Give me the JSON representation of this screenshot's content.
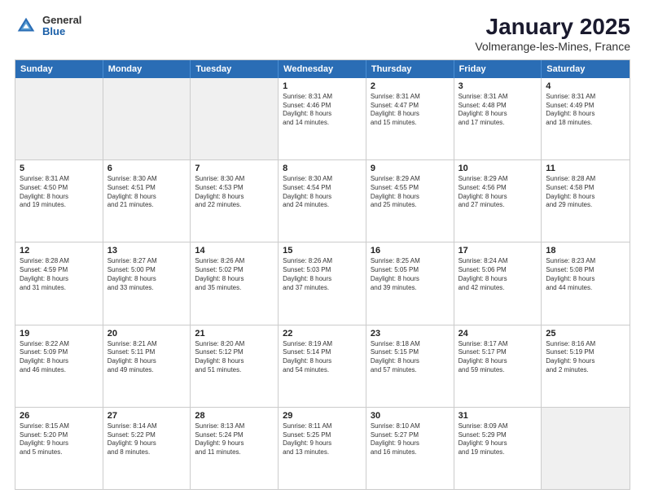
{
  "app": {
    "logo_general": "General",
    "logo_blue": "Blue"
  },
  "header": {
    "title": "January 2025",
    "subtitle": "Volmerange-les-Mines, France"
  },
  "calendar": {
    "weekdays": [
      "Sunday",
      "Monday",
      "Tuesday",
      "Wednesday",
      "Thursday",
      "Friday",
      "Saturday"
    ],
    "rows": [
      [
        {
          "day": "",
          "info": "",
          "shaded": true
        },
        {
          "day": "",
          "info": "",
          "shaded": true
        },
        {
          "day": "",
          "info": "",
          "shaded": true
        },
        {
          "day": "1",
          "info": "Sunrise: 8:31 AM\nSunset: 4:46 PM\nDaylight: 8 hours\nand 14 minutes."
        },
        {
          "day": "2",
          "info": "Sunrise: 8:31 AM\nSunset: 4:47 PM\nDaylight: 8 hours\nand 15 minutes."
        },
        {
          "day": "3",
          "info": "Sunrise: 8:31 AM\nSunset: 4:48 PM\nDaylight: 8 hours\nand 17 minutes."
        },
        {
          "day": "4",
          "info": "Sunrise: 8:31 AM\nSunset: 4:49 PM\nDaylight: 8 hours\nand 18 minutes."
        }
      ],
      [
        {
          "day": "5",
          "info": "Sunrise: 8:31 AM\nSunset: 4:50 PM\nDaylight: 8 hours\nand 19 minutes."
        },
        {
          "day": "6",
          "info": "Sunrise: 8:30 AM\nSunset: 4:51 PM\nDaylight: 8 hours\nand 21 minutes."
        },
        {
          "day": "7",
          "info": "Sunrise: 8:30 AM\nSunset: 4:53 PM\nDaylight: 8 hours\nand 22 minutes."
        },
        {
          "day": "8",
          "info": "Sunrise: 8:30 AM\nSunset: 4:54 PM\nDaylight: 8 hours\nand 24 minutes."
        },
        {
          "day": "9",
          "info": "Sunrise: 8:29 AM\nSunset: 4:55 PM\nDaylight: 8 hours\nand 25 minutes."
        },
        {
          "day": "10",
          "info": "Sunrise: 8:29 AM\nSunset: 4:56 PM\nDaylight: 8 hours\nand 27 minutes."
        },
        {
          "day": "11",
          "info": "Sunrise: 8:28 AM\nSunset: 4:58 PM\nDaylight: 8 hours\nand 29 minutes."
        }
      ],
      [
        {
          "day": "12",
          "info": "Sunrise: 8:28 AM\nSunset: 4:59 PM\nDaylight: 8 hours\nand 31 minutes."
        },
        {
          "day": "13",
          "info": "Sunrise: 8:27 AM\nSunset: 5:00 PM\nDaylight: 8 hours\nand 33 minutes."
        },
        {
          "day": "14",
          "info": "Sunrise: 8:26 AM\nSunset: 5:02 PM\nDaylight: 8 hours\nand 35 minutes."
        },
        {
          "day": "15",
          "info": "Sunrise: 8:26 AM\nSunset: 5:03 PM\nDaylight: 8 hours\nand 37 minutes."
        },
        {
          "day": "16",
          "info": "Sunrise: 8:25 AM\nSunset: 5:05 PM\nDaylight: 8 hours\nand 39 minutes."
        },
        {
          "day": "17",
          "info": "Sunrise: 8:24 AM\nSunset: 5:06 PM\nDaylight: 8 hours\nand 42 minutes."
        },
        {
          "day": "18",
          "info": "Sunrise: 8:23 AM\nSunset: 5:08 PM\nDaylight: 8 hours\nand 44 minutes."
        }
      ],
      [
        {
          "day": "19",
          "info": "Sunrise: 8:22 AM\nSunset: 5:09 PM\nDaylight: 8 hours\nand 46 minutes."
        },
        {
          "day": "20",
          "info": "Sunrise: 8:21 AM\nSunset: 5:11 PM\nDaylight: 8 hours\nand 49 minutes."
        },
        {
          "day": "21",
          "info": "Sunrise: 8:20 AM\nSunset: 5:12 PM\nDaylight: 8 hours\nand 51 minutes."
        },
        {
          "day": "22",
          "info": "Sunrise: 8:19 AM\nSunset: 5:14 PM\nDaylight: 8 hours\nand 54 minutes."
        },
        {
          "day": "23",
          "info": "Sunrise: 8:18 AM\nSunset: 5:15 PM\nDaylight: 8 hours\nand 57 minutes."
        },
        {
          "day": "24",
          "info": "Sunrise: 8:17 AM\nSunset: 5:17 PM\nDaylight: 8 hours\nand 59 minutes."
        },
        {
          "day": "25",
          "info": "Sunrise: 8:16 AM\nSunset: 5:19 PM\nDaylight: 9 hours\nand 2 minutes."
        }
      ],
      [
        {
          "day": "26",
          "info": "Sunrise: 8:15 AM\nSunset: 5:20 PM\nDaylight: 9 hours\nand 5 minutes."
        },
        {
          "day": "27",
          "info": "Sunrise: 8:14 AM\nSunset: 5:22 PM\nDaylight: 9 hours\nand 8 minutes."
        },
        {
          "day": "28",
          "info": "Sunrise: 8:13 AM\nSunset: 5:24 PM\nDaylight: 9 hours\nand 11 minutes."
        },
        {
          "day": "29",
          "info": "Sunrise: 8:11 AM\nSunset: 5:25 PM\nDaylight: 9 hours\nand 13 minutes."
        },
        {
          "day": "30",
          "info": "Sunrise: 8:10 AM\nSunset: 5:27 PM\nDaylight: 9 hours\nand 16 minutes."
        },
        {
          "day": "31",
          "info": "Sunrise: 8:09 AM\nSunset: 5:29 PM\nDaylight: 9 hours\nand 19 minutes."
        },
        {
          "day": "",
          "info": "",
          "shaded": true
        }
      ]
    ]
  }
}
